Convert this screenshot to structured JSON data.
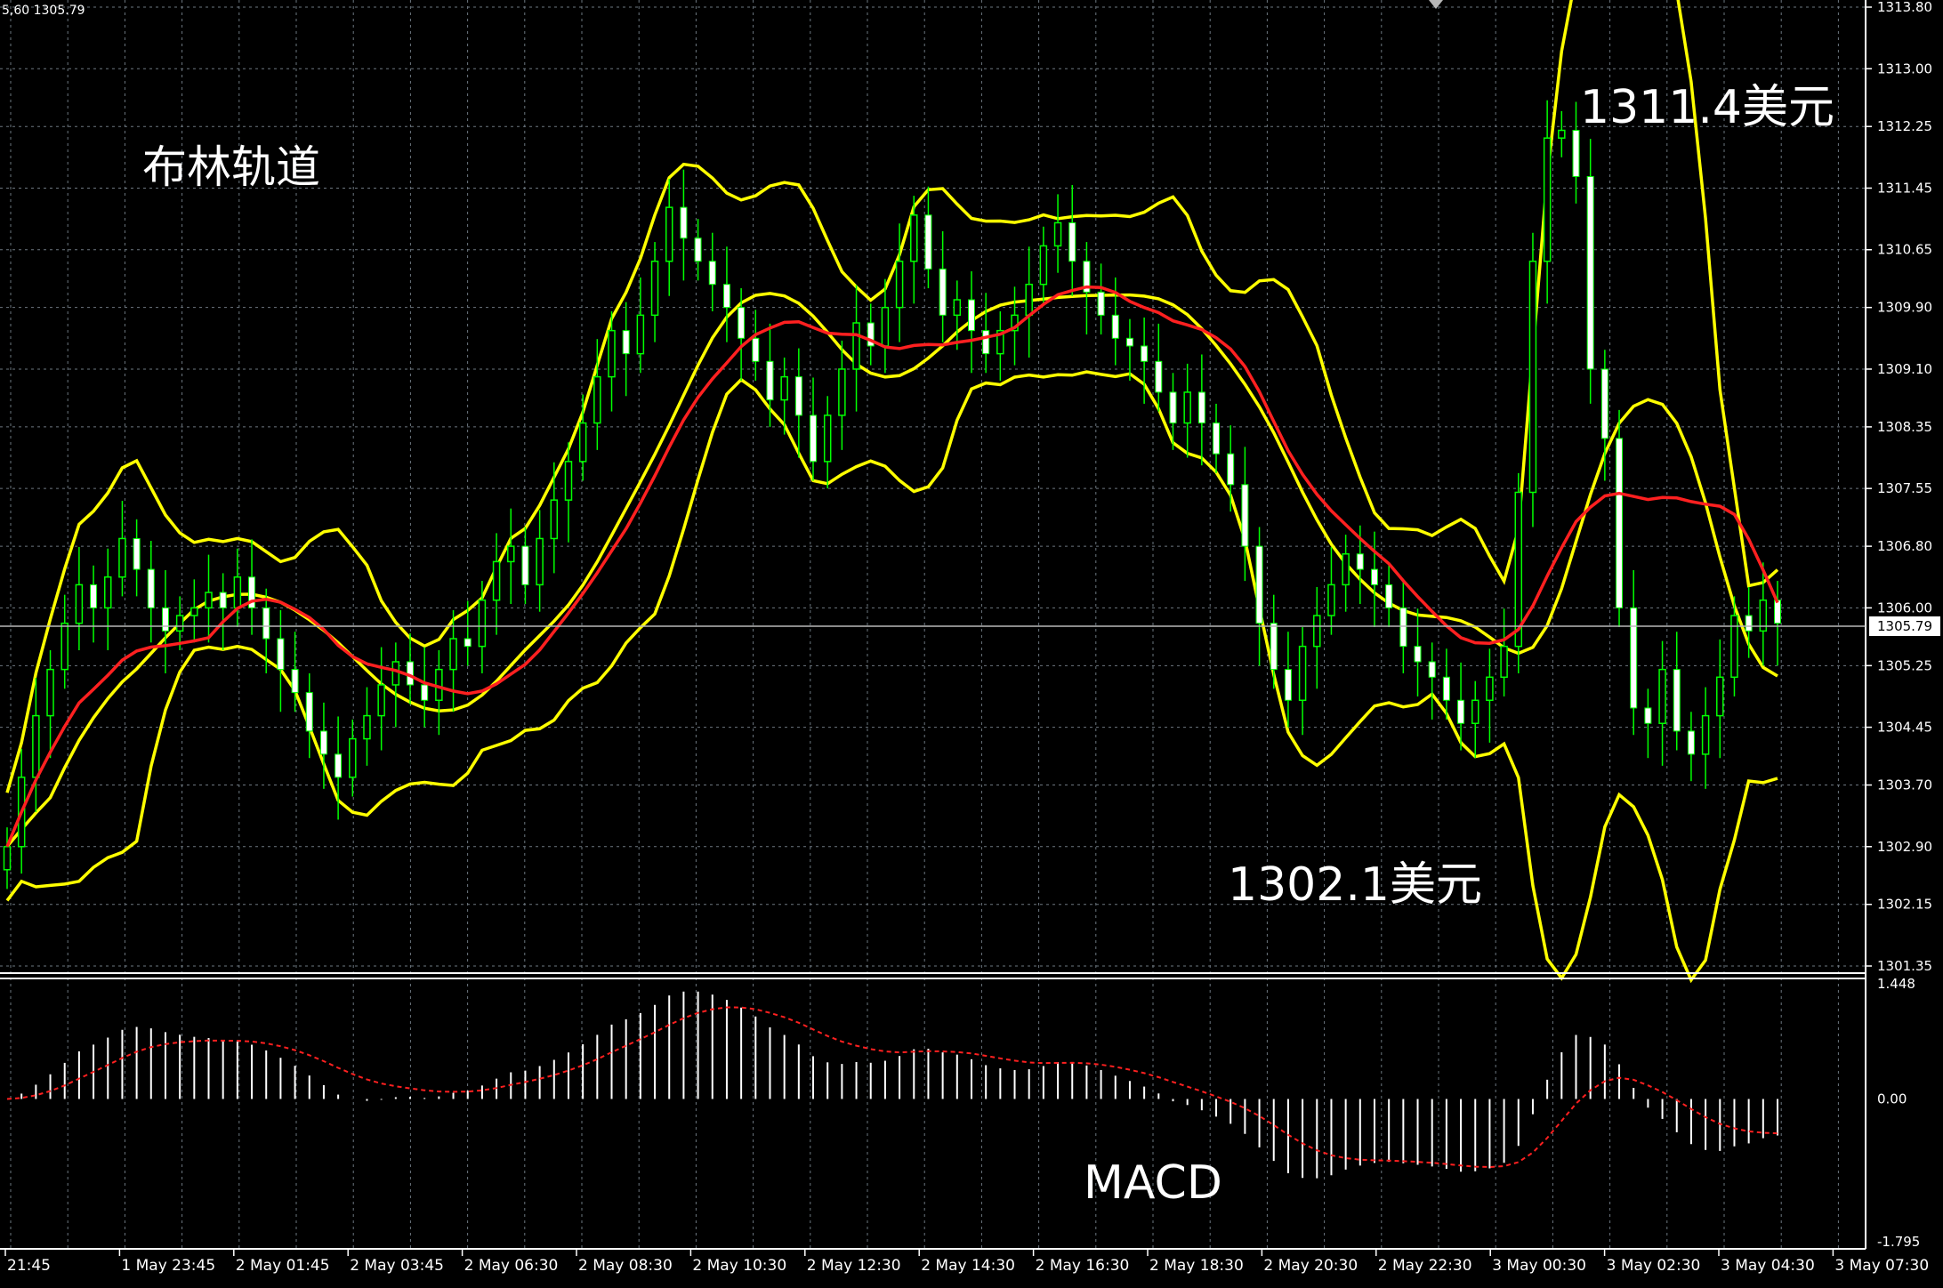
{
  "header": {
    "symbol_info": "5,60 1305.79"
  },
  "annotations": {
    "bollinger": "布林轨道",
    "high_price": "1311.4美元",
    "low_price": "1302.1美元",
    "macd": "MACD"
  },
  "price_axis": {
    "ticks": [
      "1313.80",
      "1313.00",
      "1312.25",
      "1311.45",
      "1310.65",
      "1309.90",
      "1309.10",
      "1308.35",
      "1307.55",
      "1306.80",
      "1306.00",
      "1305.25",
      "1304.45",
      "1303.70",
      "1302.90",
      "1302.15",
      "1301.35"
    ],
    "current_price": "1305.79"
  },
  "macd_axis": {
    "ticks": [
      "1.448",
      "0.00",
      "-1.795"
    ]
  },
  "time_axis": {
    "labels": [
      "21:45",
      "1 May 23:45",
      "2 May 01:45",
      "2 May 03:45",
      "2 May 06:30",
      "2 May 08:30",
      "2 May 10:30",
      "2 May 12:30",
      "2 May 14:30",
      "2 May 16:30",
      "2 May 18:30",
      "2 May 20:30",
      "2 May 22:30",
      "3 May 00:30",
      "3 May 02:30",
      "3 May 04:30",
      "3 May 07:30"
    ]
  },
  "colors": {
    "background": "#000000",
    "grid": "#6d7780",
    "candle": "#00ff00",
    "bollinger_bands": "#ffff00",
    "moving_average": "#ff2020",
    "macd_hist": "#ffffff",
    "macd_signal": "#ff2020",
    "text": "#ffffff"
  },
  "chart_data": [
    {
      "type": "candlestick",
      "title": "",
      "ylim": [
        1301.35,
        1313.8
      ],
      "close": [
        1302.9,
        1303.8,
        1304.6,
        1305.2,
        1305.8,
        1306.3,
        1306.0,
        1306.4,
        1306.9,
        1306.5,
        1306.0,
        1305.7,
        1305.9,
        1306.0,
        1306.2,
        1306.0,
        1306.4,
        1306.0,
        1305.6,
        1305.2,
        1304.9,
        1304.4,
        1304.1,
        1303.8,
        1304.3,
        1304.6,
        1305.0,
        1305.3,
        1305.0,
        1304.8,
        1305.2,
        1305.6,
        1305.5,
        1306.1,
        1306.6,
        1306.8,
        1306.3,
        1306.9,
        1307.4,
        1307.9,
        1308.4,
        1309.0,
        1309.6,
        1309.3,
        1309.8,
        1310.5,
        1311.2,
        1310.8,
        1310.5,
        1310.2,
        1309.9,
        1309.5,
        1309.2,
        1308.7,
        1309.0,
        1308.5,
        1307.9,
        1308.5,
        1309.1,
        1309.7,
        1309.4,
        1309.9,
        1310.5,
        1311.1,
        1310.4,
        1309.8,
        1310.0,
        1309.6,
        1309.3,
        1309.6,
        1309.8,
        1310.2,
        1310.7,
        1311.0,
        1310.5,
        1310.1,
        1309.8,
        1309.5,
        1309.4,
        1309.2,
        1308.8,
        1308.4,
        1308.8,
        1308.4,
        1308.0,
        1307.6,
        1306.8,
        1305.8,
        1305.2,
        1304.8,
        1305.5,
        1305.9,
        1306.3,
        1306.7,
        1306.5,
        1306.3,
        1306.0,
        1305.5,
        1305.3,
        1305.1,
        1304.8,
        1304.5,
        1304.8,
        1305.1,
        1305.5,
        1307.5,
        1310.5,
        1312.1,
        1312.2,
        1311.6,
        1309.1,
        1308.2,
        1306.0,
        1304.7,
        1304.5,
        1305.2,
        1304.4,
        1304.1,
        1304.6,
        1305.1,
        1305.9,
        1305.7,
        1306.1,
        1305.8
      ],
      "series": [
        {
          "name": "",
          "role": "bollinger_upper"
        },
        {
          "name": "",
          "role": "bollinger_middle"
        },
        {
          "name": "",
          "role": "bollinger_lower"
        },
        {
          "name": "",
          "role": "moving_average"
        }
      ]
    },
    {
      "type": "bar",
      "title": "MACD",
      "ylim": [
        -1.795,
        1.448
      ]
    }
  ]
}
